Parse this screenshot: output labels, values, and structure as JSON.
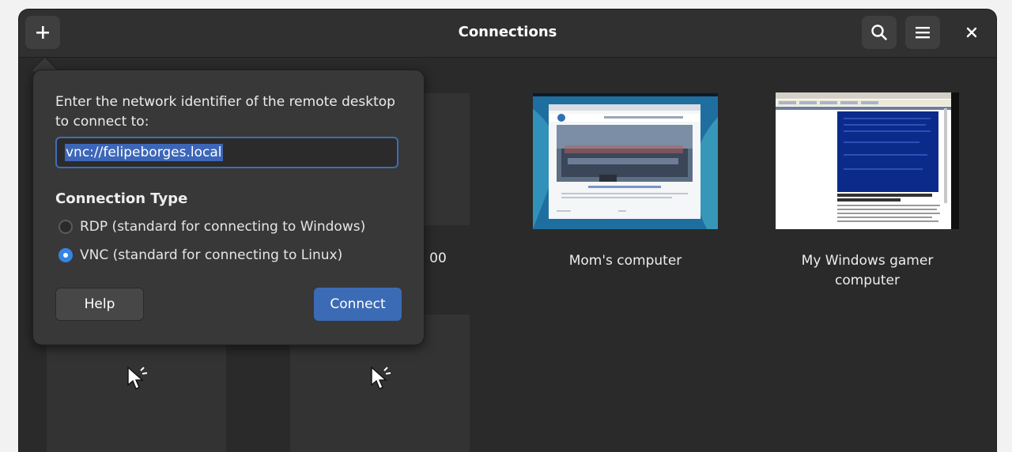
{
  "window": {
    "title": "Connections"
  },
  "header": {
    "add_icon": "plus-icon",
    "search_icon": "search-icon",
    "menu_icon": "hamburger-menu-icon",
    "close_icon": "close-icon"
  },
  "popover": {
    "description": "Enter the network identifier of the remote desktop to connect to:",
    "address_value": "vnc://felipeborges.local",
    "section_label": "Connection Type",
    "options": [
      {
        "label": "RDP (standard for connecting to Windows)",
        "checked": false
      },
      {
        "label": "VNC (standard for connecting to Linux)",
        "checked": true
      }
    ],
    "help_label": "Help",
    "connect_label": "Connect"
  },
  "connections": [
    {
      "name": "Mom's computer"
    },
    {
      "name": "My Windows gamer computer"
    }
  ],
  "partial_label_fragment": "00",
  "colors": {
    "accent": "#3584e4",
    "connect_button": "#3c6bb5",
    "window_bg": "#2a2a2a",
    "popover_bg": "#383838"
  }
}
